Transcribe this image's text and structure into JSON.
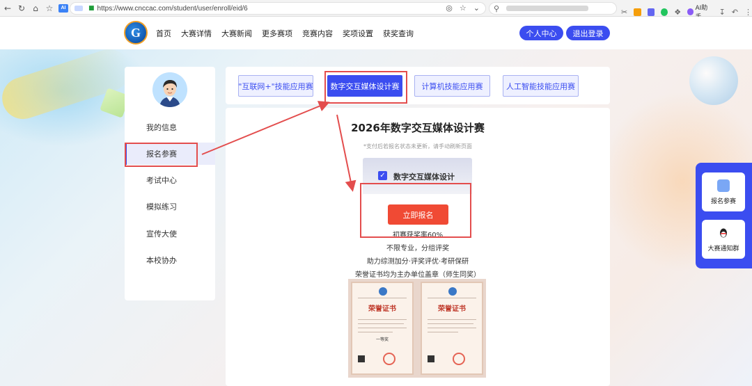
{
  "browser": {
    "url": "https://www.cnccac.com/student/user/enroll/eid/6",
    "ai_badge": "AI",
    "ai_helper": "AI助手"
  },
  "header": {
    "logo_text": "G",
    "nav": [
      "首页",
      "大赛详情",
      "大赛新闻",
      "更多赛项",
      "竞赛内容",
      "奖项设置",
      "获奖查询"
    ],
    "personal_center": "个人中心",
    "logout": "退出登录"
  },
  "sidebar": {
    "items": [
      {
        "label": "我的信息"
      },
      {
        "label": "报名参赛"
      },
      {
        "label": "考试中心"
      },
      {
        "label": "模拟练习"
      },
      {
        "label": "宣传大使"
      },
      {
        "label": "本校协办"
      }
    ],
    "active_index": 1
  },
  "tabs": [
    {
      "label": "\"互联网+\"技能应用赛"
    },
    {
      "label": "数字交互媒体设计赛"
    },
    {
      "label": "计算机技能应用赛"
    },
    {
      "label": "人工智能技能应用赛"
    }
  ],
  "content": {
    "title": "2026年数字交互媒体设计赛",
    "notice": "*支付后若报名状态未更新，请手动刷新页面",
    "card_label": "数字交互媒体设计",
    "signup_button": "立即报名",
    "features": [
      "初赛获奖率60%",
      "不限专业，分组评奖",
      "助力综测加分·评奖评优·考研保研",
      "荣誉证书均为主办单位盖章（师生同奖）"
    ],
    "certificates": [
      {
        "title": "荣誉证书",
        "award": "一等奖"
      },
      {
        "title": "荣誉证书",
        "award": ""
      }
    ]
  },
  "float_panel": {
    "items": [
      {
        "label": "报名参赛",
        "icon": "register-icon"
      },
      {
        "label": "大赛通知群",
        "icon": "qq-icon"
      }
    ]
  },
  "colors": {
    "primary": "#3b4df0",
    "signup": "#f04a34",
    "annotation": "#e34d4d"
  }
}
